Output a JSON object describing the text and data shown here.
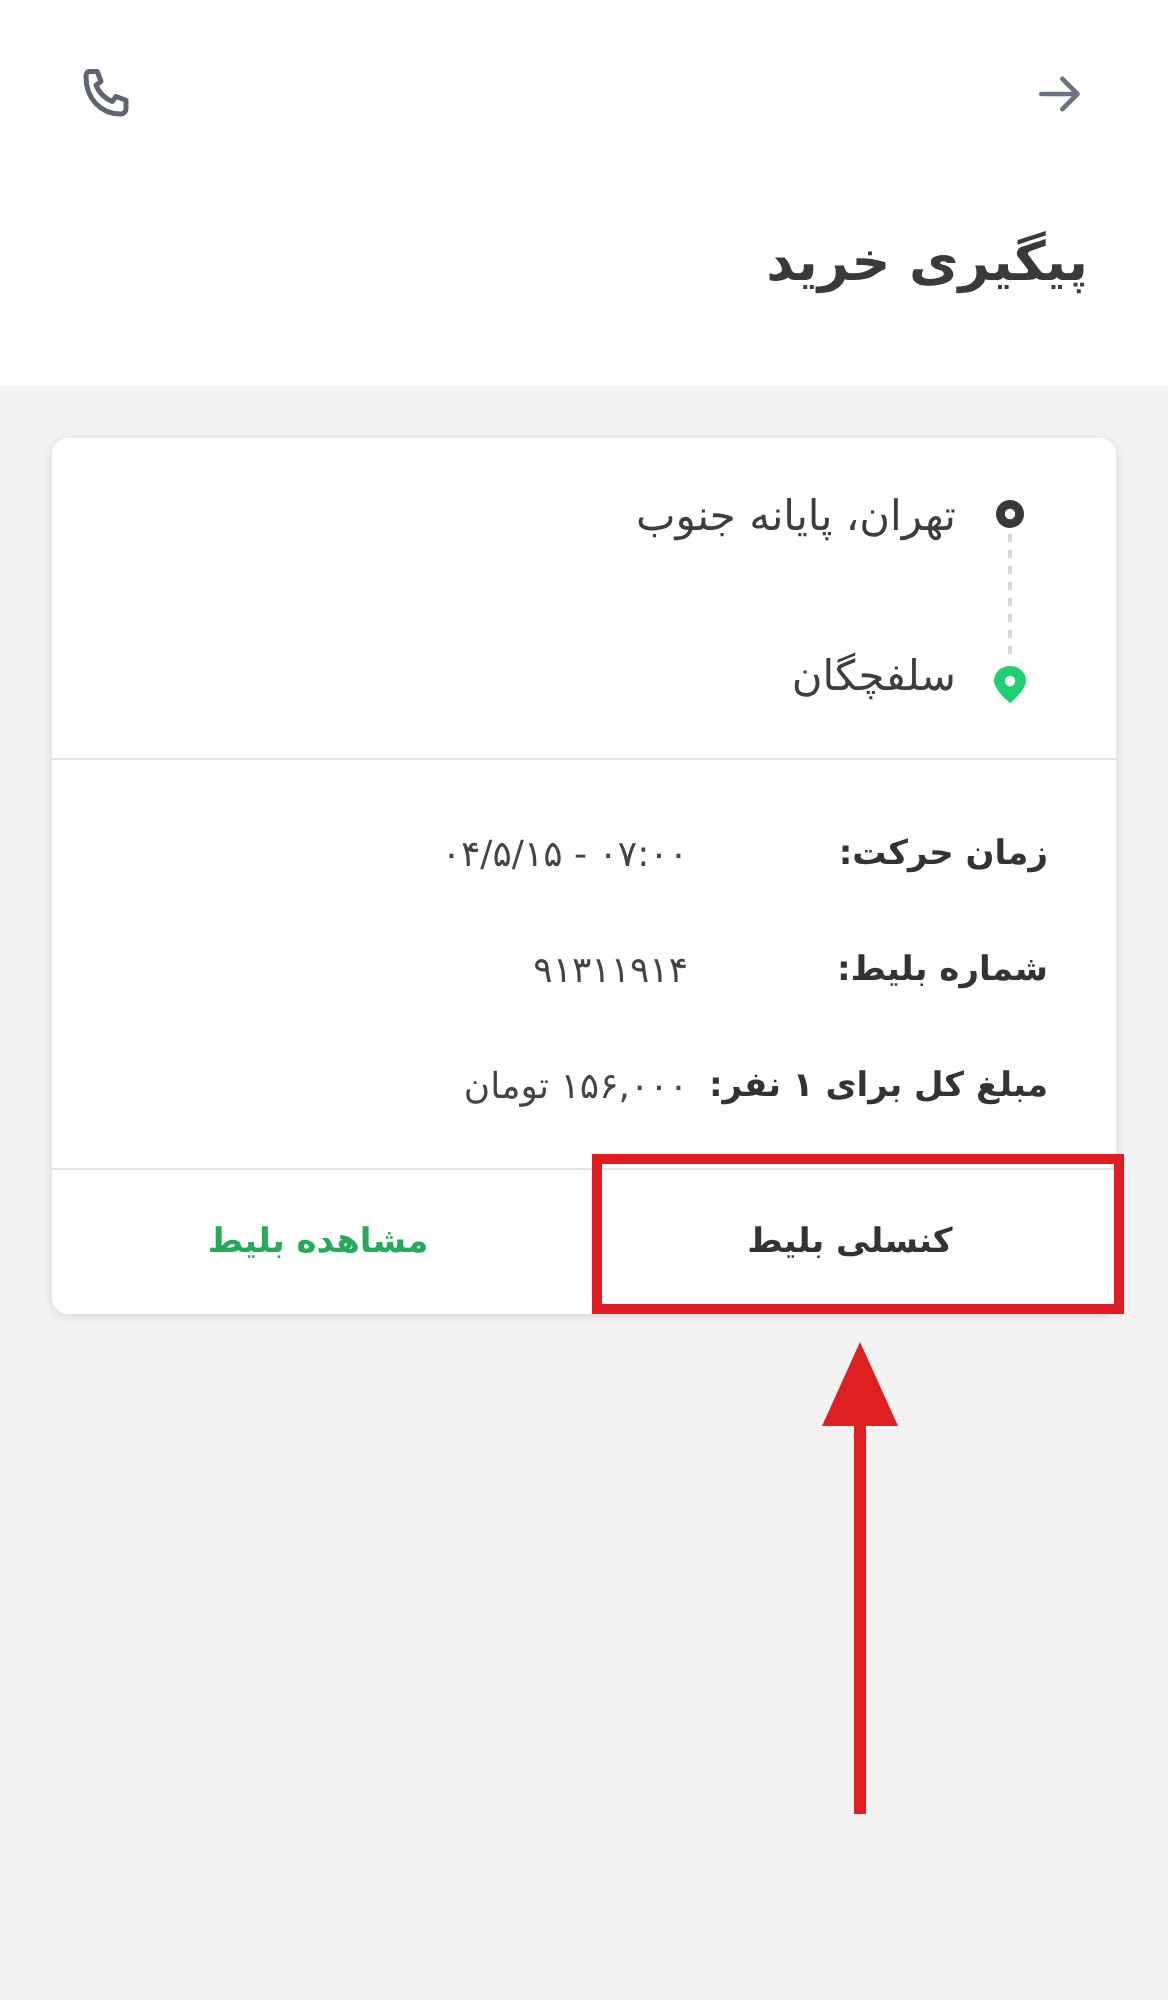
{
  "header": {
    "title": "پیگیری خرید"
  },
  "route": [
    {
      "kind": "origin",
      "name": "تهران، پایانه جنوب"
    },
    {
      "kind": "destination",
      "name": "سلفچگان"
    }
  ],
  "details": [
    {
      "label": "زمان حرکت:",
      "value": "۰۷:۰۰ - ۰۴/۵/۱۵"
    },
    {
      "label": "شماره بلیط:",
      "value": "۹۱۳۱۱۹۱۴"
    },
    {
      "label": "مبلغ کل برای ۱ نفر:",
      "value": "۱۵۶,۰۰۰ تومان"
    }
  ],
  "actions": [
    {
      "label": "کنسلی بلیط",
      "kind": "plain",
      "highlighted": true
    },
    {
      "label": "مشاهده بلیط",
      "kind": "primary",
      "highlighted": false
    }
  ]
}
